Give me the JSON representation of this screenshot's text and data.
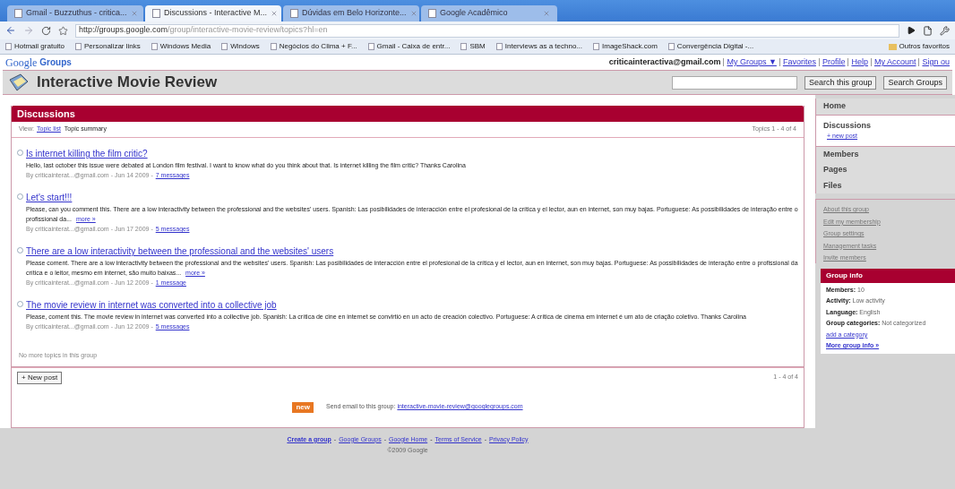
{
  "browser": {
    "tabs": [
      {
        "label": "Gmail - Buzzuthus - critica...",
        "selected": false
      },
      {
        "label": "Discussions - Interactive M...",
        "selected": true
      },
      {
        "label": "Dúvidas em Belo Horizonte...",
        "selected": false
      },
      {
        "label": "Google Acadêmico",
        "selected": false
      }
    ],
    "address": {
      "host": "http://groups.google.com",
      "path": "/group/interactive-movie-review/topics?hl=en"
    },
    "bookmarks": [
      "Hotmail gratuito",
      "Personalizar links",
      "Windows Media",
      "Windows",
      "Negócios do Clima + F...",
      "Gmail - Caixa de entr...",
      "SBM",
      "Interviews as a techno...",
      "ImageShack.com",
      "Convergência Digital -..."
    ],
    "other_bookmarks": "Outros favoritos"
  },
  "header": {
    "logo": "Google",
    "product": "Groups",
    "account_links": [
      "criticainteractiva@gmail.com",
      "My Groups ▼",
      "Favorites",
      "Profile",
      "Help",
      "My Account",
      "Sign ou"
    ]
  },
  "group": {
    "title": "Interactive Movie Review",
    "search_buttons": [
      "Search this group",
      "Search Groups"
    ]
  },
  "discussions": {
    "title": "Discussions",
    "view_label": "View:",
    "view_options": [
      {
        "label": "Topic list",
        "selected": false
      },
      {
        "label": "Topic summary",
        "selected": true
      }
    ],
    "range": "Topics 1 - 4 of 4",
    "topics": [
      {
        "title": "Is internet killing the film critic?",
        "excerpt": "Hello, last october this issue were debated at London film festival. I want to know what do you think about that. Is internet killing the film critic? Thanks Carolina",
        "byline": "By criticainterat...@gmail.com - Jun 14 2009 -",
        "messages": "7 messages"
      },
      {
        "title": "Let's start!!!",
        "excerpt": "Please, can you comment this. There are a low interactivity between the professional and the websites' users. Spanish: Las posibilidades de interacción entre el profesional de la crítica y el lector, aun en internet, son muy bajas. Portuguese: As possibilidades de interação entre o profissional da...",
        "more": "more »",
        "byline": "By criticainterat...@gmail.com - Jun 17 2009 -",
        "messages": "5 messages"
      },
      {
        "title": "There are a low interactivity between the professional and the websites' users",
        "excerpt": "Please coment. There are a low interactivity between the professional and the websites' users. Spanish: Las posibilidades de interacción entre el profesional de la crítica y el lector, aun en internet, son muy bajas. Portuguese: As possibilidades de interação entre o profissional da crítica e o leitor, mesmo em internet, são muito baixas...",
        "more": "more »",
        "byline": "By criticainterat...@gmail.com - Jun 12 2009 -",
        "messages": "1 message"
      },
      {
        "title": "The movie review in internet was converted into a collective job",
        "excerpt": "Please, coment this. The movie review in internet was converted into a collective job. Spanish: La crítica de cine en internet se convirtió en un acto de creación colectivo. Portuguese: A crítica de cinema em internet é um ato de criação coletivo. Thanks Carolina",
        "byline": "By criticainterat...@gmail.com - Jun 12 2009 -",
        "messages": "5 messages"
      }
    ],
    "no_more": "No more topics in this group",
    "new_post": "+ New post",
    "bottom_range": "1 - 4 of 4",
    "email_badge": "new",
    "email_label": "Send email to this group:",
    "email": "interactive-movie-review@googlegroups.com"
  },
  "footer": {
    "separator": "-",
    "links": [
      "Create a group",
      "Google Groups",
      "Google Home",
      "Terms of Service",
      "Privacy Policy"
    ],
    "copyright": "©2009 Google"
  },
  "sidebar": {
    "nav": [
      {
        "label": "Home",
        "selected": false
      },
      {
        "label": "Discussions",
        "selected": true,
        "sub": "+ new post"
      },
      {
        "label": "Members",
        "selected": false
      },
      {
        "label": "Pages",
        "selected": false
      },
      {
        "label": "Files",
        "selected": false
      }
    ],
    "links": [
      "About this group",
      "Edit my membership",
      "Group settings",
      "Management tasks",
      "Invite members"
    ],
    "info_title": "Group info",
    "info": [
      {
        "key": "Members:",
        "value": "10"
      },
      {
        "key": "Activity:",
        "value": "Low activity"
      },
      {
        "key": "Language:",
        "value": "English"
      },
      {
        "key": "Group categories:",
        "value": "Not categorized"
      }
    ],
    "add_category": "add a category",
    "more_info": "More group info »"
  }
}
